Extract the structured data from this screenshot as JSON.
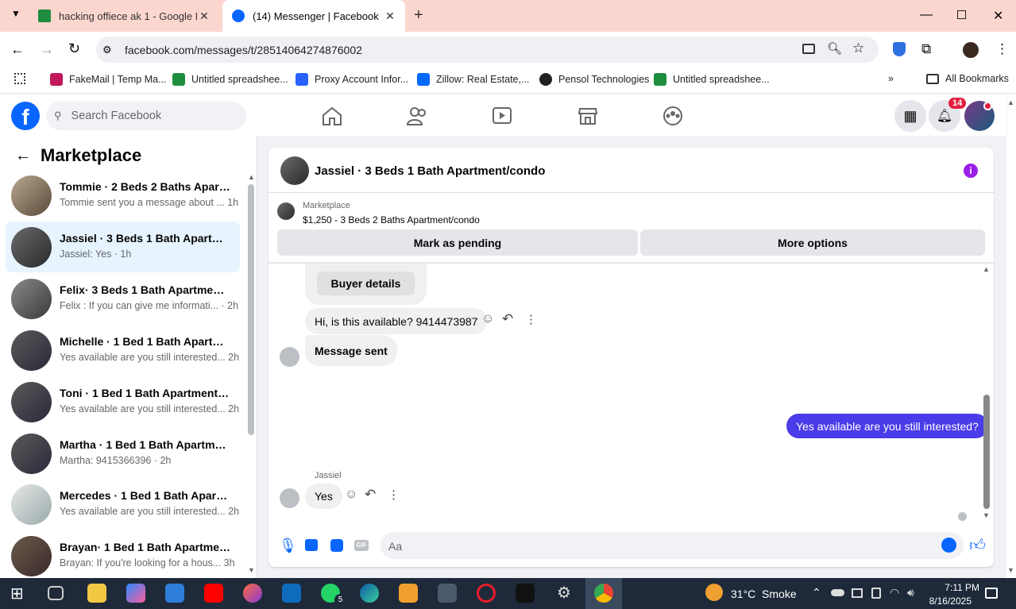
{
  "browser": {
    "tabs": [
      {
        "title": "hacking offiece ak 1 - Google D"
      },
      {
        "title": "(14) Messenger | Facebook"
      }
    ],
    "url": "facebook.com/messages/t/28514064274876002",
    "bookmarks": [
      "FakeMail | Temp Ma...",
      "Untitled spreadshee...",
      "Proxy Account Infor...",
      "Zillow: Real Estate,...",
      "Pensol Technologies",
      "Untitled spreadshee..."
    ],
    "all_bookmarks": "All Bookmarks"
  },
  "fb": {
    "search_placeholder": "Search Facebook",
    "notif_count": "14",
    "brand_color": "#0866ff"
  },
  "sidebar": {
    "title": "Marketplace",
    "conversations": [
      {
        "name": "Tommie · 2 Beds 2 Baths Apart...",
        "snippet": "Tommie sent you a message about ... 1h"
      },
      {
        "name": "Jassiel · 3 Beds 1 Bath Apartmen...",
        "snippet": "Jassiel: Yes · 1h"
      },
      {
        "name": "Felix· 3 Beds 1 Bath Apartment/...",
        "snippet": "Felix : If you can give me informati... · 2h"
      },
      {
        "name": "Michelle · 1 Bed 1 Bath Apartme...",
        "snippet": "Yes available are you still interested... 2h"
      },
      {
        "name": "Toni · 1 Bed 1 Bath Apartment/c...",
        "snippet": "Yes available are you still interested... 2h"
      },
      {
        "name": "Martha · 1 Bed 1 Bath Apartmen...",
        "snippet": "Martha: 9415366396 · 2h"
      },
      {
        "name": "Mercedes · 1 Bed 1 Bath Apartm...",
        "snippet": "Yes available are you still interested... 2h"
      },
      {
        "name": "Brayan· 1 Bed 1 Bath Apartment...",
        "snippet": "Brayan: If you're looking for a hous... 3h"
      }
    ]
  },
  "chat": {
    "title": "Jassiel · 3 Beds 1 Bath Apartment/condo",
    "listing_label": "Marketplace",
    "listing_title": "$1,250 - 3 Beds 2 Baths Apartment/condo",
    "mark_pending": "Mark as pending",
    "more_options": "More options",
    "buyer_details": "Buyer details",
    "msg1": "Hi, is this available? 9414473987",
    "msg2": "Message sent",
    "my_msg": "Yes available are you still interested?",
    "sender": "Jassiel",
    "reply": "Yes",
    "composer_placeholder": "Aa",
    "accent": "#4a3ce8"
  },
  "taskbar": {
    "weather": "31°C  Smoke",
    "time": "7:11 PM",
    "date": "8/16/2025",
    "whatsapp_badge": "5"
  }
}
